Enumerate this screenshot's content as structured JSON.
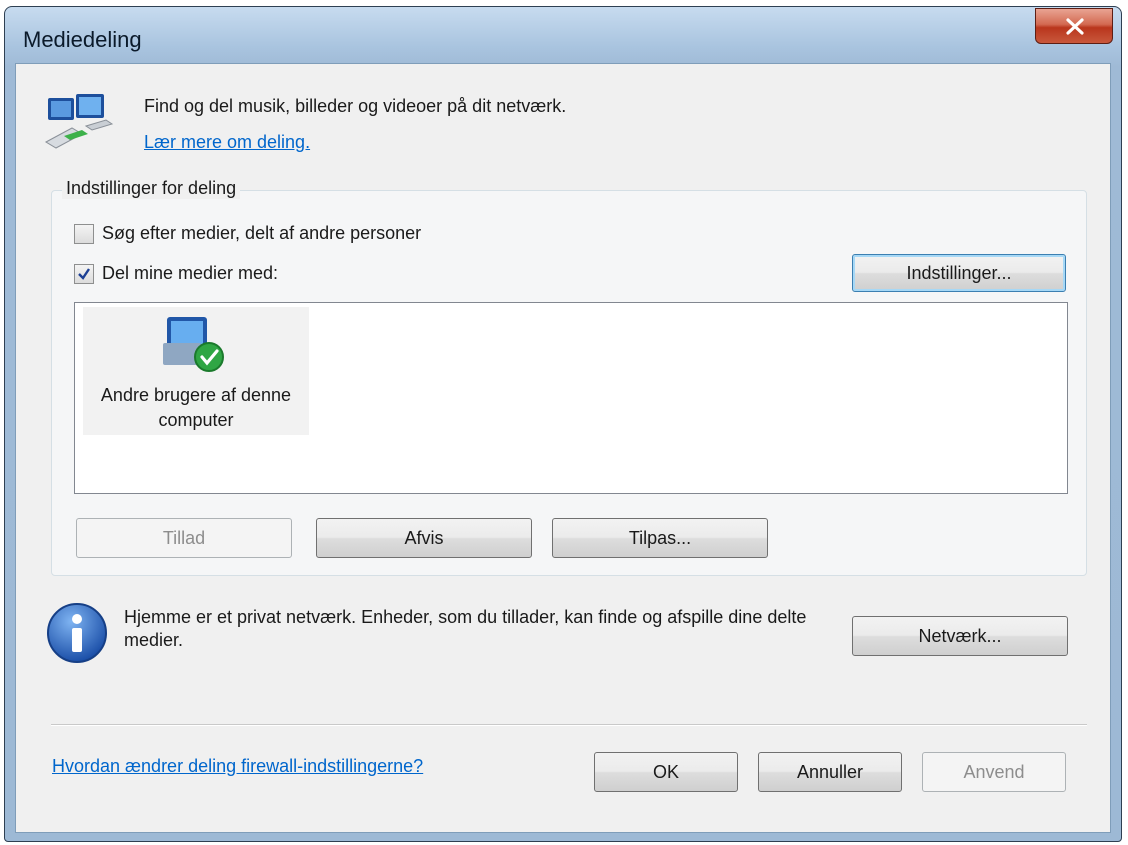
{
  "window": {
    "title": "Mediedeling"
  },
  "header": {
    "description": "Find og del musik, billeder og videoer på dit netværk.",
    "learn_more_link": "Lær mere om deling."
  },
  "sharing_settings": {
    "group_title": "Indstillinger for deling",
    "search_media": {
      "label": "Søg efter medier, delt af andre personer",
      "checked": false
    },
    "share_media": {
      "label": "Del mine medier med:",
      "checked": true
    },
    "settings_button": "Indstillinger...",
    "devices": [
      {
        "label": "Andre brugere af denne computer",
        "status": "allowed"
      }
    ],
    "allow_button": "Tillad",
    "deny_button": "Afvis",
    "customize_button": "Tilpas..."
  },
  "info": {
    "text": "Hjemme er et privat netværk. Enheder, som du tillader, kan finde og afspille dine delte medier.",
    "network_button": "Netværk..."
  },
  "footer": {
    "firewall_link": "Hvordan ændrer deling firewall-indstillingerne?",
    "ok_button": "OK",
    "cancel_button": "Annuller",
    "apply_button": "Anvend"
  }
}
